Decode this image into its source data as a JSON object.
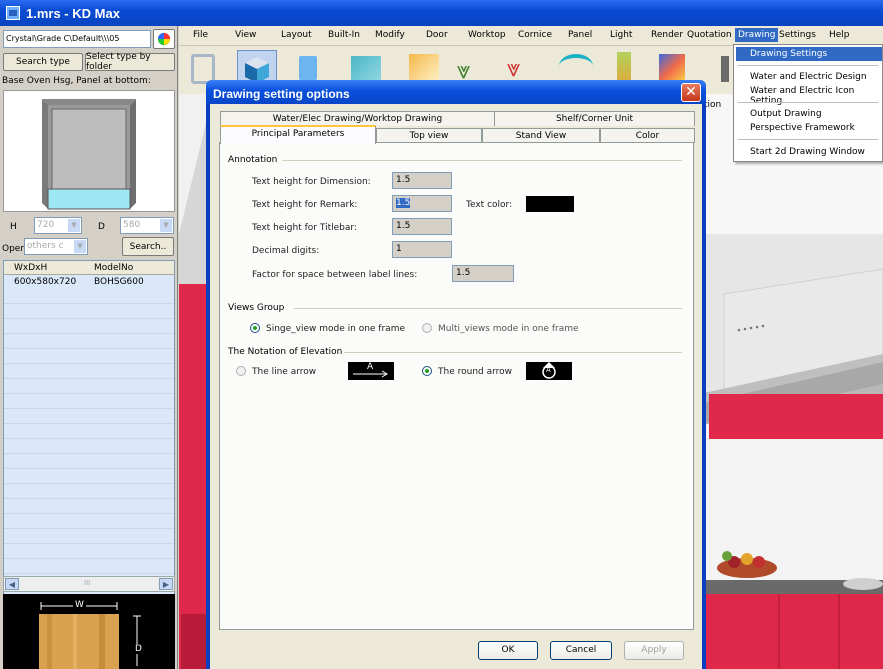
{
  "app": {
    "title": "1.mrs - KD Max"
  },
  "left_panel": {
    "path": "Crystal\\Grade C\\Default\\\\\\05",
    "search_type_label": "Search type",
    "select_folder_label": "Select type by folder",
    "category": "Base Oven Hsg, Panel at bottom:",
    "h_label": "H",
    "h_value": "720",
    "d_label": "D",
    "d_value": "580",
    "open_label": "Open",
    "open_value": "others c",
    "search_button": "Search..",
    "table": {
      "headers": [
        "WxDxH",
        "ModelNo"
      ],
      "rows": [
        [
          "600x580x720",
          "BOHSG600"
        ]
      ]
    },
    "scroll_mid": "III",
    "thumb_w": "W",
    "thumb_d": "D"
  },
  "menu": {
    "items": [
      "File",
      "View",
      "Layout",
      "Built-In",
      "Modify",
      "Door",
      "Worktop",
      "Cornice",
      "Panel",
      "Light",
      "Render",
      "Quotation",
      "Drawing",
      "Settings",
      "Help"
    ]
  },
  "drawing_menu": {
    "items": [
      "Drawing Settings",
      "Water and Electric Design",
      "Water and Electric Icon Setting",
      "Output Drawing",
      "Perspective Framework",
      "Start 2d Drawing Window"
    ]
  },
  "behind_tab_text": "tion",
  "dialog": {
    "title": "Drawing setting options",
    "close_glyph": "✕",
    "tabs_back": [
      "Water/Elec Drawing/Worktop Drawing",
      "Shelf/Corner Unit"
    ],
    "tabs_front": [
      "Principal Parameters",
      "Top view",
      "Stand View",
      "Color"
    ],
    "annotation": {
      "group": "Annotation",
      "dimension_label": "Text height for Dimension:",
      "dimension_value": "1.5",
      "remark_label": "Text height for Remark:",
      "remark_value": "1.5",
      "text_color_label": "Text color:",
      "titlebar_label": "Text height for Titlebar:",
      "titlebar_value": "1.5",
      "decimal_label": "Decimal digits:",
      "decimal_value": "1",
      "factor_label": "Factor for space between label lines:",
      "factor_value": "1.5"
    },
    "views_group": {
      "group": "Views Group",
      "single": "Singe_view mode in one frame",
      "multi": "Multi_views mode in one frame"
    },
    "elevation": {
      "group": "The Notation of Elevation",
      "line_arrow": "The line arrow",
      "line_arrow_glyph": "A",
      "round_arrow": "The round arrow",
      "round_arrow_glyph": "A"
    },
    "buttons": {
      "ok": "OK",
      "cancel": "Cancel",
      "apply": "Apply"
    }
  },
  "colors": {
    "kitchen_red": "#e0284a",
    "xp_blue": "#0a4bd4",
    "text_color": "#000000"
  }
}
